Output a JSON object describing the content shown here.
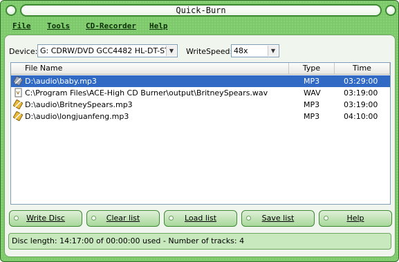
{
  "window": {
    "title": "Quick-Burn"
  },
  "menu": {
    "items": [
      "File",
      "Tools",
      "CD-Recorder",
      "Help"
    ]
  },
  "device": {
    "label": "Device:",
    "value": "G: CDRW/DVD GCC4482 HL-DT-ST",
    "speed_label": "WriteSpeed:",
    "speed_value": "48x"
  },
  "list": {
    "columns": [
      "File Name",
      "Type",
      "Time"
    ],
    "rows": [
      {
        "name": "D:\\audio\\baby.mp3",
        "type": "MP3",
        "time": "03:29:00",
        "selected": true,
        "icon": "mp3-file-icon"
      },
      {
        "name": "C:\\Program Files\\ACE-High CD Burner\\output\\BritneySpears.wav",
        "type": "WAV",
        "time": "03:19:00",
        "selected": false,
        "icon": "wav-file-icon"
      },
      {
        "name": "D:\\audio\\BritneySpears.mp3",
        "type": "MP3",
        "time": "03:19:00",
        "selected": false,
        "icon": "mp3-file-icon"
      },
      {
        "name": "D:\\audio\\longjuanfeng.mp3",
        "type": "MP3",
        "time": "04:10:00",
        "selected": false,
        "icon": "mp3-file-icon"
      }
    ]
  },
  "buttons": {
    "write": "Write Disc",
    "clear": "Clear list",
    "load": "Load list",
    "save": "Save list",
    "help": "Help"
  },
  "status": {
    "text": "Disc length: 14:17:00 of 00:00:00 used -  Number of tracks: 4"
  },
  "colors": {
    "frame": "#7dc96b",
    "selection": "#316ac5",
    "button": "#a8d89a"
  }
}
